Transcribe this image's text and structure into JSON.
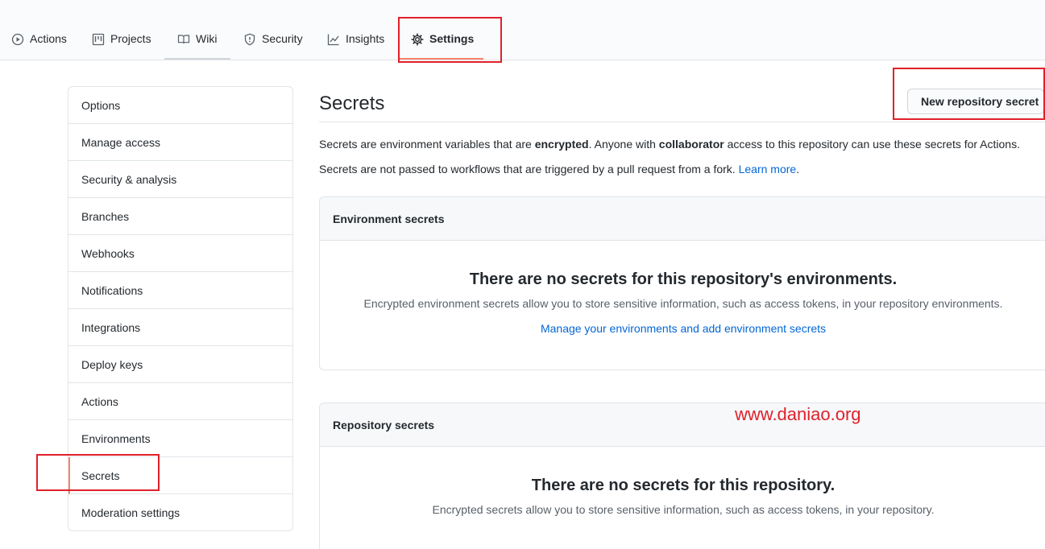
{
  "nav": {
    "tabs": [
      {
        "label": "Actions",
        "icon": "play-icon"
      },
      {
        "label": "Projects",
        "icon": "project-icon"
      },
      {
        "label": "Wiki",
        "icon": "book-icon"
      },
      {
        "label": "Security",
        "icon": "shield-icon"
      },
      {
        "label": "Insights",
        "icon": "graph-icon"
      },
      {
        "label": "Settings",
        "icon": "gear-icon",
        "active": true
      }
    ]
  },
  "sidebar": {
    "items": [
      {
        "label": "Options"
      },
      {
        "label": "Manage access"
      },
      {
        "label": "Security & analysis"
      },
      {
        "label": "Branches"
      },
      {
        "label": "Webhooks"
      },
      {
        "label": "Notifications"
      },
      {
        "label": "Integrations"
      },
      {
        "label": "Deploy keys"
      },
      {
        "label": "Actions"
      },
      {
        "label": "Environments"
      },
      {
        "label": "Secrets",
        "selected": true
      },
      {
        "label": "Moderation settings"
      }
    ]
  },
  "main": {
    "title": "Secrets",
    "new_button": "New repository secret",
    "desc1": {
      "p1": "Secrets are environment variables that are ",
      "b1": "encrypted",
      "p2": ". Anyone with ",
      "b2": "collaborator",
      "p3": " access to this repository can use these secrets for Actions."
    },
    "desc2": {
      "text": "Secrets are not passed to workflows that are triggered by a pull request from a fork. ",
      "link": "Learn more",
      "end": "."
    },
    "env_box": {
      "header": "Environment secrets",
      "blank_title": "There are no secrets for this repository's environments.",
      "blank_desc": "Encrypted environment secrets allow you to store sensitive information, such as access tokens, in your repository environments.",
      "link": "Manage your environments and add environment secrets"
    },
    "repo_box": {
      "header": "Repository secrets",
      "blank_title": "There are no secrets for this repository.",
      "blank_desc": "Encrypted secrets allow you to store sensitive information, such as access tokens, in your repository."
    }
  },
  "watermark": "www.daniao.org",
  "colors": {
    "accent_underline": "#f9826c",
    "link": "#0366d6",
    "annotation_red": "#e0202a"
  }
}
